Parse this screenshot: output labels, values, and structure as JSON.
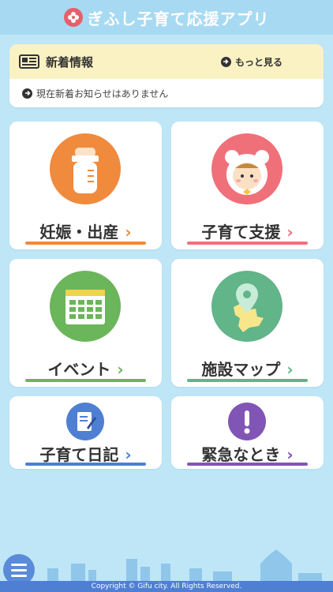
{
  "header": {
    "title": "ぎふし子育て応援アプリ"
  },
  "news": {
    "title": "新着情報",
    "more_label": "もっと見る",
    "empty_message": "現在新着お知らせはありません"
  },
  "menu": {
    "pregnancy": "妊娠・出産",
    "childcare": "子育て支援",
    "event": "イベント",
    "facility_map": "施設マップ",
    "diary": "子育て日記",
    "emergency": "緊急なとき"
  },
  "footer": {
    "copyright": "Copyright © Gifu city. All Rights Reserved."
  },
  "colors": {
    "pregnancy": "#f08a3c",
    "childcare": "#f0707a",
    "event": "#6bb55a",
    "facility_map": "#62b489",
    "diary": "#4e7fd3",
    "emergency": "#8155b5"
  },
  "icons": {
    "pregnancy": "baby-bottle-icon",
    "childcare": "baby-face-icon",
    "event": "calendar-icon",
    "facility_map": "map-pin-icon",
    "diary": "notebook-pen-icon",
    "emergency": "exclamation-icon"
  }
}
